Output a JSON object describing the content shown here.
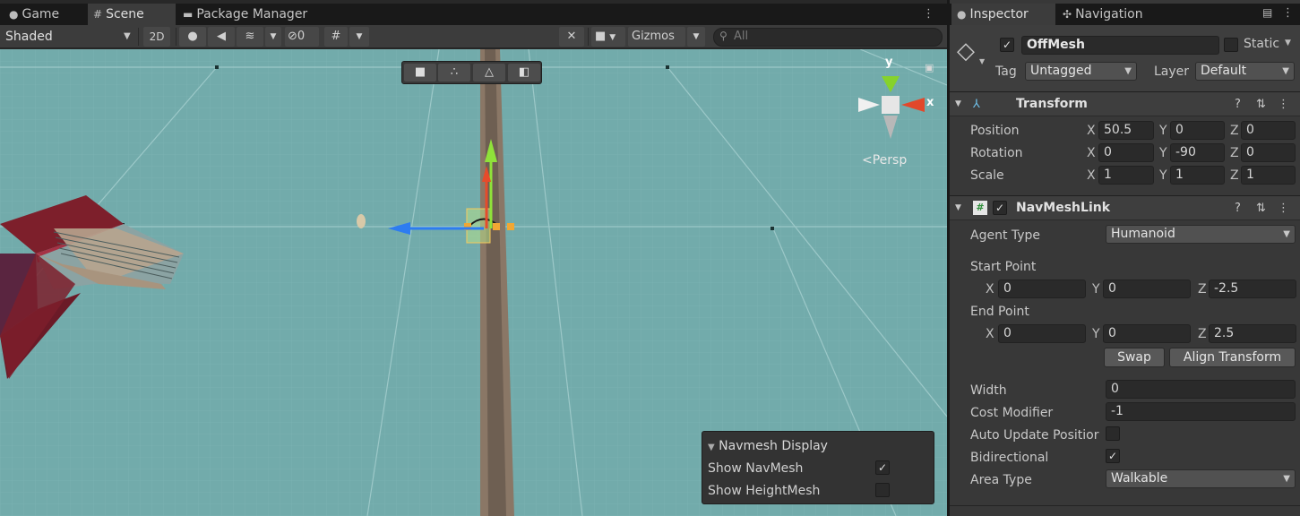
{
  "tabs": [
    {
      "label": "Game",
      "icon": "gamepad-icon"
    },
    {
      "label": "Scene",
      "icon": "grid-icon"
    },
    {
      "label": "Package Manager",
      "icon": "package-icon"
    }
  ],
  "toolbar": {
    "shading_mode": "Shaded",
    "mode_2d": "2D",
    "hidden_count": "0",
    "gizmos_label": "Gizmos",
    "search_placeholder": "All"
  },
  "viewport": {
    "persp_label": "Persp",
    "gizmo_axes": {
      "y": "y",
      "x": "x"
    },
    "tool_buttons": [
      "cube-icon",
      "vertex-icon",
      "edge-icon",
      "face-icon"
    ]
  },
  "navmesh_overlay": {
    "title": "Navmesh Display",
    "show_navmesh_label": "Show NavMesh",
    "show_navmesh_checked": true,
    "show_heightmesh_label": "Show HeightMesh",
    "show_heightmesh_checked": false
  },
  "right_tabs": [
    {
      "label": "Inspector",
      "icon": "info-icon"
    },
    {
      "label": "Navigation",
      "icon": "navigation-icon"
    }
  ],
  "inspector": {
    "object_name": "OffMesh",
    "active_checked": true,
    "static_label": "Static",
    "tag_label": "Tag",
    "tag_value": "Untagged",
    "layer_label": "Layer",
    "layer_value": "Default",
    "transform": {
      "title": "Transform",
      "rows": [
        {
          "label": "Position",
          "x": "50.5",
          "y": "0",
          "z": "0"
        },
        {
          "label": "Rotation",
          "x": "0",
          "y": "-90",
          "z": "0"
        },
        {
          "label": "Scale",
          "x": "1",
          "y": "1",
          "z": "1"
        }
      ]
    },
    "navmeshlink": {
      "title": "NavMeshLink",
      "enabled": true,
      "agent_type_label": "Agent Type",
      "agent_type_value": "Humanoid",
      "start_point_label": "Start Point",
      "start": {
        "x": "0",
        "y": "0",
        "z": "-2.5"
      },
      "end_point_label": "End Point",
      "end": {
        "x": "0",
        "y": "0",
        "z": "2.5"
      },
      "swap_label": "Swap",
      "align_label": "Align Transform",
      "width_label": "Width",
      "width_value": "0",
      "cost_label": "Cost Modifier",
      "cost_value": "-1",
      "auto_update_label": "Auto Update Positior",
      "auto_update_checked": false,
      "bidirectional_label": "Bidirectional",
      "bidirectional_checked": true,
      "area_type_label": "Area Type",
      "area_type_value": "Walkable"
    }
  },
  "axis_labels": {
    "x": "X",
    "y": "Y",
    "z": "Z"
  }
}
